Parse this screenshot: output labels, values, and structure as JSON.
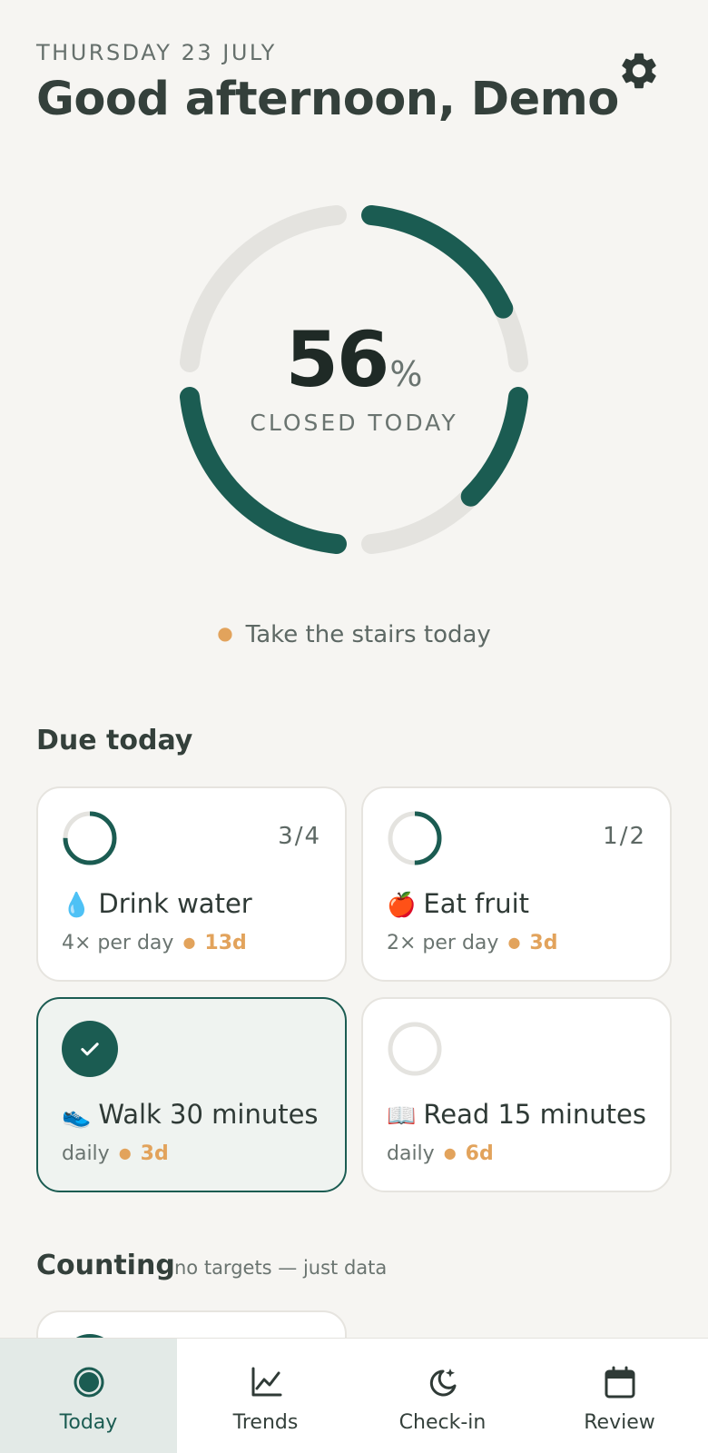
{
  "header": {
    "date": "THURSDAY 23 JULY",
    "greeting": "Good afternoon, Demo",
    "settings_icon": "gear-icon"
  },
  "progress": {
    "percent": 56,
    "percent_text": "56",
    "percent_sign": "%",
    "label": "CLOSED TODAY"
  },
  "tip": "Take the stairs today",
  "due_today": {
    "title": "Due today",
    "cards": [
      {
        "emoji": "💧",
        "name": "Drink water",
        "count": "3/4",
        "progress": 0.75,
        "frequency": "4× per day",
        "streak": "13d",
        "done": false
      },
      {
        "emoji": "🍎",
        "name": "Eat fruit",
        "count": "1/2",
        "progress": 0.5,
        "frequency": "2× per day",
        "streak": "3d",
        "done": false
      },
      {
        "emoji": "👟",
        "name": "Walk 30 minutes",
        "count": "",
        "progress": 1.0,
        "frequency": "daily",
        "streak": "3d",
        "done": true
      },
      {
        "emoji": "📖",
        "name": "Read 15 minutes",
        "count": "",
        "progress": 0,
        "frequency": "daily",
        "streak": "6d",
        "done": false
      }
    ]
  },
  "counting": {
    "title": "Counting",
    "subtitle": "no targets — just data"
  },
  "nav": {
    "items": [
      {
        "label": "Today",
        "icon": "today-circle-icon",
        "active": true
      },
      {
        "label": "Trends",
        "icon": "chart-line-icon",
        "active": false
      },
      {
        "label": "Check-in",
        "icon": "moon-star-icon",
        "active": false
      },
      {
        "label": "Review",
        "icon": "calendar-icon",
        "active": false
      }
    ]
  },
  "colors": {
    "accent": "#1b5c52",
    "track": "#e4e3df",
    "streak": "#e2a35c",
    "background": "#f6f5f2"
  }
}
